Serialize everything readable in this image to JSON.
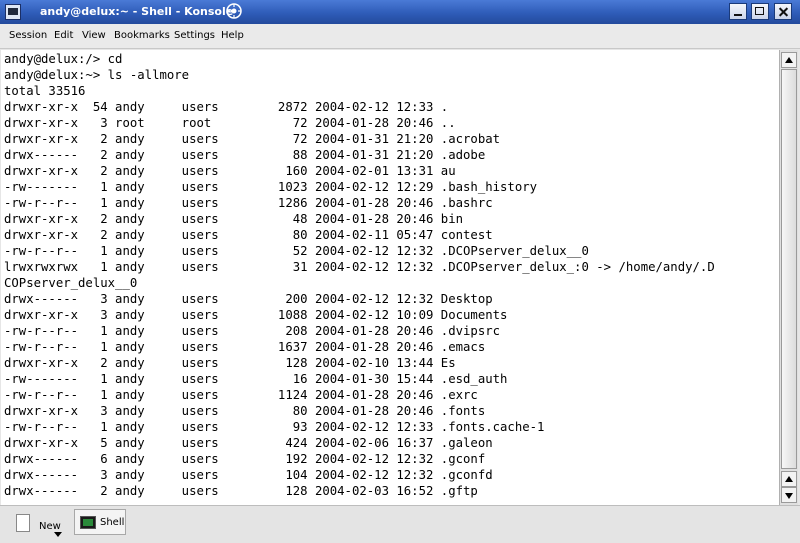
{
  "window": {
    "title": "andy@delux:~ - Shell - Konsole"
  },
  "menu": [
    "Session",
    "Edit",
    "View",
    "Bookmarks",
    "Settings",
    "Help"
  ],
  "terminal_lines": [
    "andy@delux:/> cd",
    "andy@delux:~> ls -allmore",
    "total 33516",
    "drwxr-xr-x  54 andy     users        2872 2004-02-12 12:33 .",
    "drwxr-xr-x   3 root     root           72 2004-01-28 20:46 ..",
    "drwxr-xr-x   2 andy     users          72 2004-01-31 21:20 .acrobat",
    "drwx------   2 andy     users          88 2004-01-31 21:20 .adobe",
    "drwxr-xr-x   2 andy     users         160 2004-02-01 13:31 au",
    "-rw-------   1 andy     users        1023 2004-02-12 12:29 .bash_history",
    "-rw-r--r--   1 andy     users        1286 2004-01-28 20:46 .bashrc",
    "drwxr-xr-x   2 andy     users          48 2004-01-28 20:46 bin",
    "drwxr-xr-x   2 andy     users          80 2004-02-11 05:47 contest",
    "-rw-r--r--   1 andy     users          52 2004-02-12 12:32 .DCOPserver_delux__0",
    "lrwxrwxrwx   1 andy     users          31 2004-02-12 12:32 .DCOPserver_delux_:0 -> /home/andy/.D",
    "COPserver_delux__0",
    "drwx------   3 andy     users         200 2004-02-12 12:32 Desktop",
    "drwxr-xr-x   3 andy     users        1088 2004-02-12 10:09 Documents",
    "-rw-r--r--   1 andy     users         208 2004-01-28 20:46 .dvipsrc",
    "-rw-r--r--   1 andy     users        1637 2004-01-28 20:46 .emacs",
    "drwxr-xr-x   2 andy     users         128 2004-02-10 13:44 Es",
    "-rw-------   1 andy     users          16 2004-01-30 15:44 .esd_auth",
    "-rw-r--r--   1 andy     users        1124 2004-01-28 20:46 .exrc",
    "drwxr-xr-x   3 andy     users          80 2004-01-28 20:46 .fonts",
    "-rw-r--r--   1 andy     users          93 2004-02-12 12:33 .fonts.cache-1",
    "drwxr-xr-x   5 andy     users         424 2004-02-06 16:37 .galeon",
    "drwx------   6 andy     users         192 2004-02-12 12:32 .gconf",
    "drwx------   3 andy     users         104 2004-02-12 12:32 .gconfd",
    "drwx------   2 andy     users         128 2004-02-03 16:52 .gftp"
  ],
  "tabbar": {
    "new_label": "New",
    "shell_label": "Shell"
  },
  "icons": {
    "app": "konsole-icon",
    "title_logo": "kde-logo-icon",
    "minimize": "minimize-icon",
    "maximize": "maximize-icon",
    "close": "close-icon"
  }
}
